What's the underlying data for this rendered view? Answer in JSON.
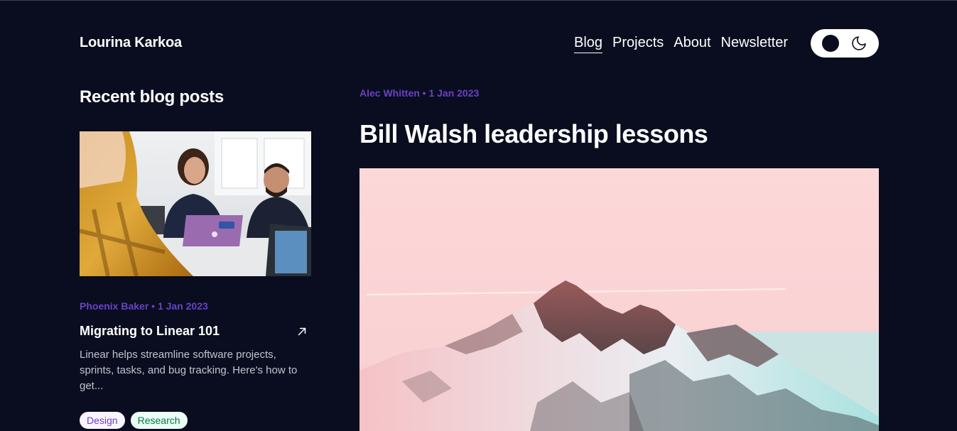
{
  "header": {
    "brand": "Lourina Karkoa",
    "nav": [
      "Blog",
      "Projects",
      "About",
      "Newsletter"
    ],
    "active_nav": "Blog",
    "theme_toggle_icons": [
      "dark-circle-icon",
      "moon-icon"
    ]
  },
  "sidebar": {
    "title": "Recent blog posts",
    "post": {
      "meta": "Phoenix Baker • 1 Jan 2023",
      "title": "Migrating to Linear 101",
      "excerpt": "Linear helps streamline software projects, sprints, tasks, and bug tracking. Here's how to get...",
      "tags": [
        "Design",
        "Research"
      ],
      "image_desc": "people working on laptops in office"
    }
  },
  "main": {
    "meta": "Alec Whitten • 1 Jan 2023",
    "title": "Bill Walsh leadership lessons",
    "image_desc": "snowy mountain peak with pink sky"
  },
  "colors": {
    "background": "#090d1f",
    "accent": "#6941c6",
    "text": "#ffffff"
  }
}
